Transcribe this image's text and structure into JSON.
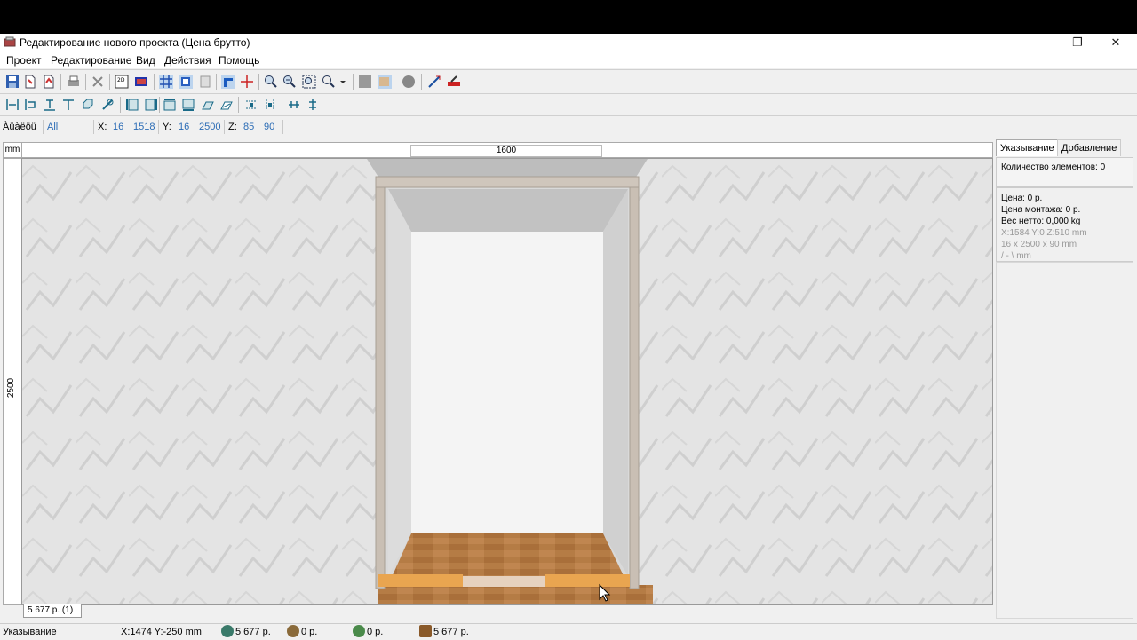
{
  "window": {
    "title": "Редактирование нового проекта (Цена брутто)",
    "controls": {
      "minimize": "–",
      "maximize": "❐",
      "close": "✕"
    }
  },
  "menu": [
    "Проект",
    "Редактирование",
    "Вид",
    "Действия",
    "Помощь"
  ],
  "toolbar1": [
    "save-icon",
    "open-icon",
    "new-icon",
    "print-icon",
    "delete-icon",
    "view-2d-icon",
    "view-3d-icon",
    "grid-icon",
    "snap-icon",
    "texture-icon",
    "wall-icon",
    "cross-icon",
    "zoom-in-icon",
    "zoom-out-icon",
    "zoom-fit-icon",
    "zoom-menu-icon",
    "solid-icon",
    "shade-icon",
    "sphere-icon",
    "measure-icon",
    "color-icon"
  ],
  "toolbar2": [
    "align-left-icon",
    "align-hcenter-icon",
    "align-top-icon",
    "align-vcenter-icon",
    "rotate-icon",
    "flip-icon",
    "to-left-icon",
    "to-right-icon",
    "to-top-icon",
    "to-bottom-icon",
    "to-front-icon",
    "to-back-icon",
    "distribute-h-icon",
    "distribute-v-icon",
    "spread-h-icon",
    "spread-v-icon"
  ],
  "coords": {
    "select_label": "Àüàëöü",
    "select_value": "All",
    "x_label": "X:",
    "x1": "16",
    "x2": "1518",
    "y_label": "Y:",
    "y1": "16",
    "y2": "2500",
    "z_label": "Z:",
    "z1": "85",
    "z2": "90"
  },
  "ruler": {
    "unit": "mm",
    "width": "1600",
    "height": "2500"
  },
  "sidepanel": {
    "tabs": [
      "Указывание",
      "Добавление"
    ],
    "count_text": "Количество элементов: 0",
    "price": "Цена:  0 р.",
    "mount_price": "Цена монтажа:  0 р.",
    "weight": "Вес нетто:  0,000 kg",
    "pos": "X:1584  Y:0  Z:510 mm",
    "dims": "16 x 2500 x 90 mm",
    "angle": "/ - \\ mm"
  },
  "bottom_tab": "5 677 р. (1)",
  "status": {
    "mode": "Указывание",
    "cursor": "X:1474  Y:-250  mm",
    "total": "5 677 р.",
    "mount": "0 р.",
    "delivery": "0 р.",
    "materials": "5 677 р."
  },
  "colors": {
    "accent": "#2a6bb5",
    "floor": "#b07840",
    "wall": "#e2e2e2",
    "frame": "#c9bfb4"
  }
}
